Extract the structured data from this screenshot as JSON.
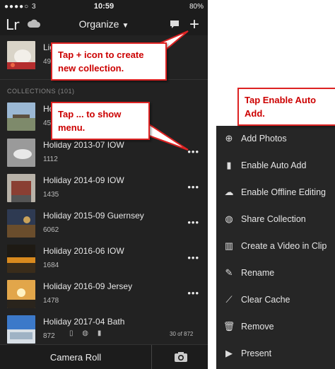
{
  "status": {
    "carrier": "●●●●○ 3",
    "time": "10:59",
    "battery": "80%"
  },
  "nav": {
    "app_logo": "Lr",
    "title": "Organize",
    "title_chevron": "⌄",
    "plus": "+"
  },
  "top_row": {
    "title": "Lig",
    "count": "49"
  },
  "section_label": "COLLECTIONS (101)",
  "rows": [
    {
      "title": "Holi",
      "count": "45"
    },
    {
      "title": "Holiday 2013-07 IOW",
      "count": "1112"
    },
    {
      "title": "Holiday 2014-09 IOW",
      "count": "1435"
    },
    {
      "title": "Holiday 2015-09 Guernsey",
      "count": "6062"
    },
    {
      "title": "Holiday 2016-06 IOW",
      "count": "1684"
    },
    {
      "title": "Holiday 2016-09 Jersey",
      "count": "1478"
    },
    {
      "title": "Holiday 2017-04 Bath",
      "count": "872"
    }
  ],
  "more_dots": "•••",
  "last_row_page": "30 of 872",
  "bottom": {
    "camera_roll": "Camera Roll"
  },
  "callouts": {
    "plus_line1": "Tap + icon to create",
    "plus_line2": "new collection.",
    "menu_line1": "Tap ... to show",
    "menu_line2": "menu.",
    "auto_line1": "Tap Enable Auto",
    "auto_line2": "Add."
  },
  "menu": [
    {
      "label": "Add Photos",
      "icon": "add-circle-icon"
    },
    {
      "label": "Enable  Auto Add",
      "icon": "auto-add-icon"
    },
    {
      "label": "Enable Offline Editing",
      "icon": "cloud-download-icon"
    },
    {
      "label": "Share Collection",
      "icon": "globe-icon"
    },
    {
      "label": "Create a Video in Clip",
      "icon": "video-clip-icon"
    },
    {
      "label": "Rename",
      "icon": "pencil-icon"
    },
    {
      "label": "Clear Cache",
      "icon": "broom-icon"
    },
    {
      "label": "Remove",
      "icon": "trash-icon"
    },
    {
      "label": "Present",
      "icon": "play-circle-icon"
    }
  ],
  "colors": {
    "callout_border": "#dd2222",
    "callout_text": "#cc0000",
    "app_bg": "#222222"
  }
}
